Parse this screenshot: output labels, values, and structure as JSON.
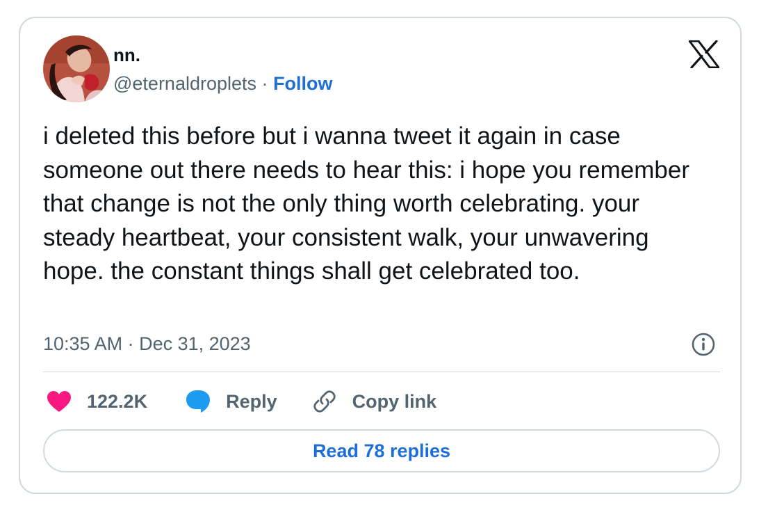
{
  "author": {
    "name": "nn.",
    "handle": "@eternaldroplets",
    "separator": "·",
    "follow_label": "Follow"
  },
  "tweet": {
    "text": "i deleted this before but i wanna tweet it again in case someone out there needs to hear this: i hope you remember that change is not the only thing worth celebrating. your steady heartbeat, your consistent walk, your unwavering hope. the constant things shall get celebrated too.",
    "timestamp": "10:35 AM · Dec 31, 2023"
  },
  "actions": {
    "like_count": "122.2K",
    "reply_label": "Reply",
    "copy_link_label": "Copy link"
  },
  "read_replies_label": "Read 78 replies",
  "icons": {
    "logo": "x-logo-icon",
    "info": "info-icon",
    "like": "heart-icon",
    "reply": "speech-bubble-icon",
    "copy": "link-icon"
  },
  "colors": {
    "accent": "#1d6fd6",
    "like": "#f91880",
    "reply": "#1d9bf0",
    "secondary_text": "#536471",
    "border": "#cfd9de"
  }
}
